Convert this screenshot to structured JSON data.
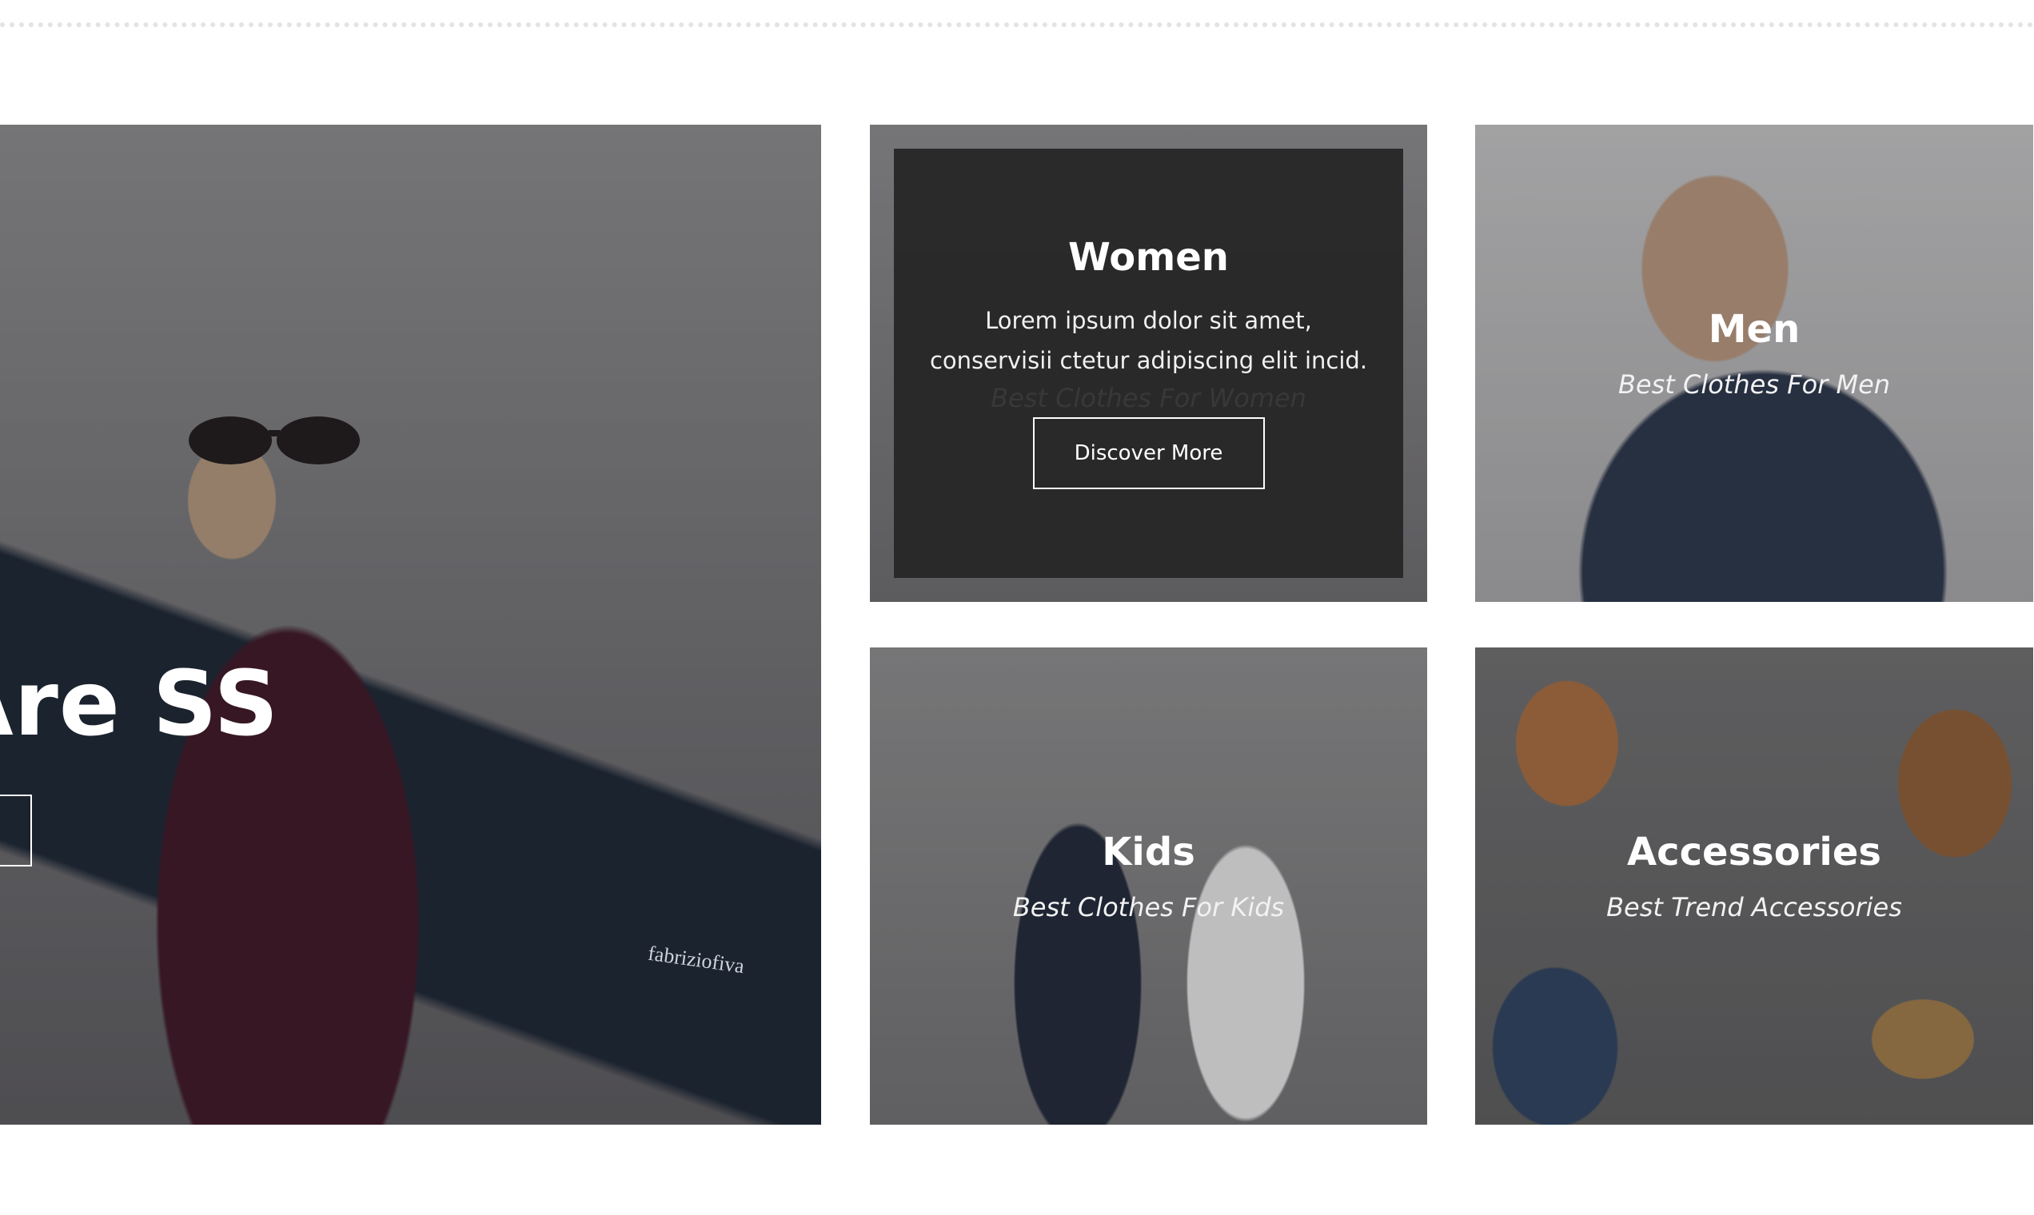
{
  "hero": {
    "title": "Are SS",
    "bag_logo": "fabriziofiva"
  },
  "categories": {
    "women": {
      "title": "Women",
      "subtitle": "Best Clothes For Women",
      "description": "Lorem ipsum dolor sit amet, conservisii ctetur adipiscing elit incid.",
      "button_label": "Discover More"
    },
    "men": {
      "title": "Men",
      "subtitle": "Best Clothes For Men"
    },
    "kids": {
      "title": "Kids",
      "subtitle": "Best Clothes For Kids"
    },
    "accessories": {
      "title": "Accessories",
      "subtitle": "Best Trend Accessories"
    }
  },
  "colors": {
    "panel": "#262626",
    "text": "#ffffff",
    "divider": "#e3e3e3"
  }
}
